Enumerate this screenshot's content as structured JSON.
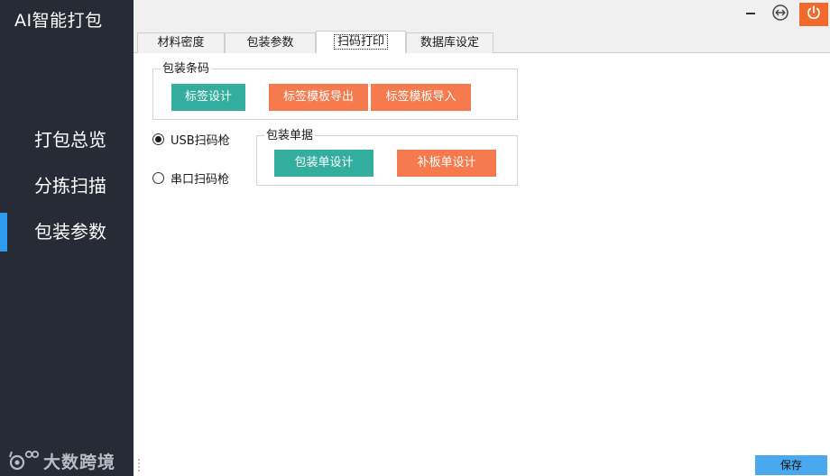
{
  "app": {
    "title": "AI智能打包"
  },
  "sidebar": {
    "items": [
      {
        "label": "打包总览",
        "active": false
      },
      {
        "label": "分拣扫描",
        "active": false
      },
      {
        "label": "包装参数",
        "active": true
      }
    ],
    "brand": {
      "text": "大数跨境",
      "icon": "brand-logo-icon"
    }
  },
  "window_controls": {
    "minimize_icon": "minimize-icon",
    "restore_icon": "restore-icon",
    "close_icon": "power-icon",
    "close_color": "#f26a2b"
  },
  "tabs": [
    {
      "label": "材料密度",
      "active": false
    },
    {
      "label": "包装参数",
      "active": false
    },
    {
      "label": "扫码打印",
      "active": true
    },
    {
      "label": "数据库设定",
      "active": false
    }
  ],
  "barcode_group": {
    "title": "包装条码",
    "buttons": {
      "label_design": "标签设计",
      "export_template": "标签模板导出",
      "import_template": "标签模板导入"
    }
  },
  "scanner": {
    "usb": {
      "label": "USB扫码枪",
      "checked": true
    },
    "serial": {
      "label": "串口扫码枪",
      "checked": false
    }
  },
  "packing_group": {
    "title": "包装单据",
    "buttons": {
      "packing_slip_design": "包装单设计",
      "pallet_slip_design": "补板单设计"
    }
  },
  "footer": {
    "save_label": "保存"
  },
  "colors": {
    "sidebar_bg": "#272b35",
    "active_indicator": "#2e9bf0",
    "teal_button": "#33ad9e",
    "orange_button": "#f57a4d",
    "save_button": "#4aa8ef"
  }
}
